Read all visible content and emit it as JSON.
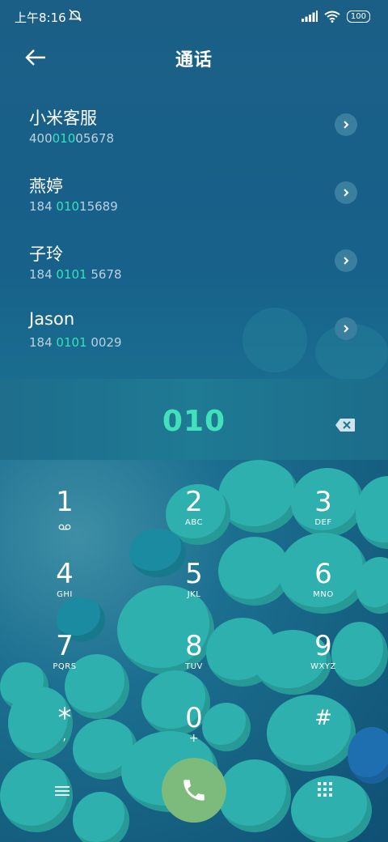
{
  "status": {
    "time": "上午8:16",
    "battery": "100",
    "icons": [
      "mute-icon",
      "signal-icon",
      "wifi-icon",
      "battery-icon"
    ]
  },
  "header": {
    "title": "通话",
    "back_icon": "arrow-left-icon"
  },
  "contacts": [
    {
      "name": "小米客服",
      "num_pre": "400",
      "num_hl": "010",
      "num_post": "05678"
    },
    {
      "name": "燕婷",
      "num_pre": "184 ",
      "num_hl": "010",
      "num_post": "15689"
    },
    {
      "name": "子玲",
      "num_pre": "184 ",
      "num_hl": "0101",
      "num_post": " 5678"
    },
    {
      "name": "Jason",
      "num_pre": "184 ",
      "num_hl": "0101",
      "num_post": " 0029"
    }
  ],
  "input": {
    "digits": "010",
    "backspace_icon": "backspace-icon"
  },
  "keypad": {
    "keys": [
      {
        "digit": "1",
        "letters": ""
      },
      {
        "digit": "2",
        "letters": "ABC"
      },
      {
        "digit": "3",
        "letters": "DEF"
      },
      {
        "digit": "4",
        "letters": "GHI"
      },
      {
        "digit": "5",
        "letters": "JKL"
      },
      {
        "digit": "6",
        "letters": "MNO"
      },
      {
        "digit": "7",
        "letters": "PQRS"
      },
      {
        "digit": "8",
        "letters": "TUV"
      },
      {
        "digit": "9",
        "letters": "WXYZ"
      },
      {
        "digit": "*",
        "letters": ","
      },
      {
        "digit": "0",
        "letters": "+"
      },
      {
        "digit": "#",
        "letters": ""
      }
    ]
  },
  "colors": {
    "accent": "#37e1b9",
    "call": "#7cbb7c",
    "background": "#1b5f86"
  }
}
